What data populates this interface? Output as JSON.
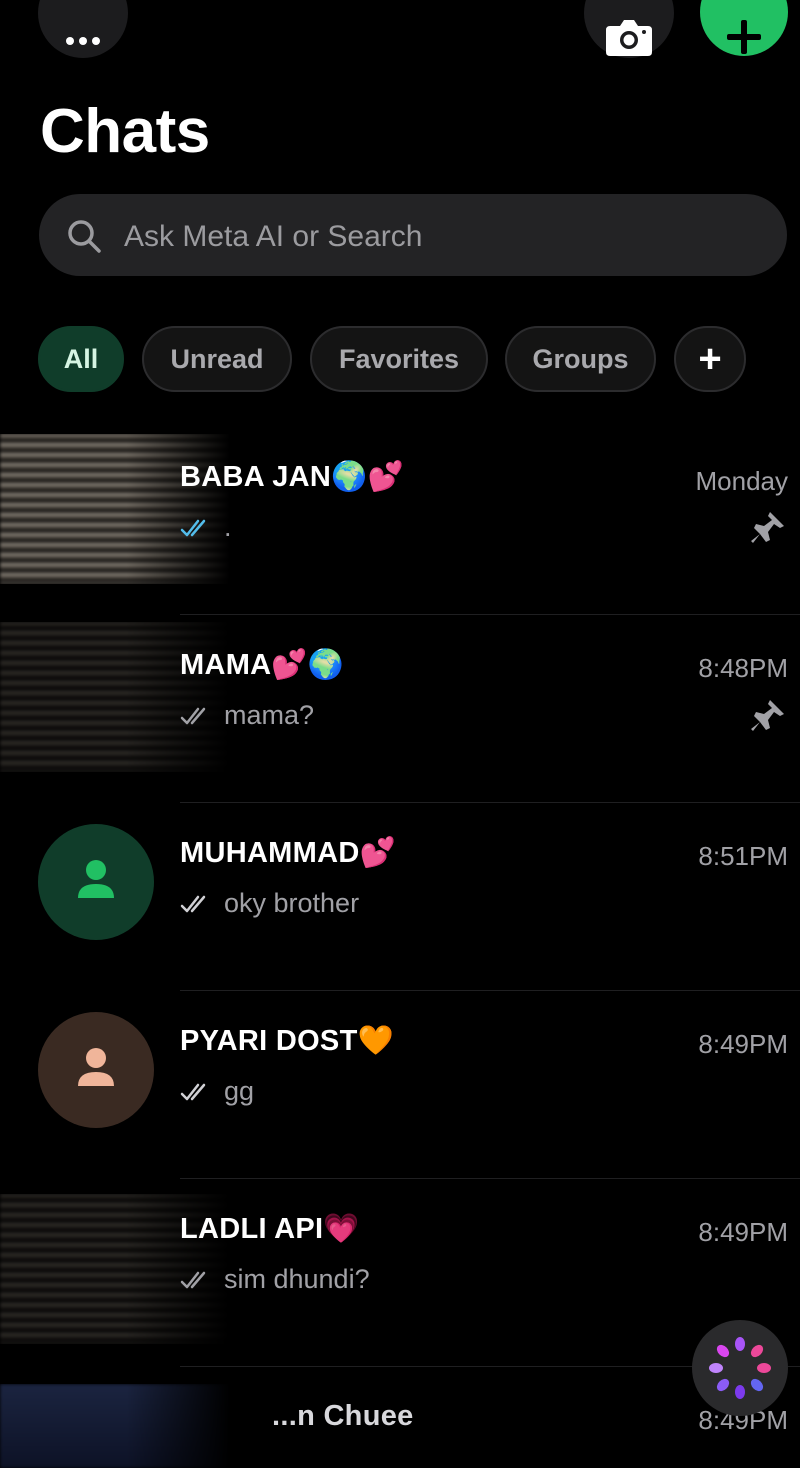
{
  "header": {
    "title": "Chats",
    "more_icon": "more-horizontal-icon",
    "camera_icon": "camera-icon",
    "new_chat_icon": "plus-icon"
  },
  "search": {
    "placeholder": "Ask Meta AI or Search",
    "icon": "search-icon"
  },
  "filters": {
    "items": [
      {
        "label": "All",
        "active": true
      },
      {
        "label": "Unread",
        "active": false
      },
      {
        "label": "Favorites",
        "active": false
      },
      {
        "label": "Groups",
        "active": false
      }
    ],
    "add_label": "+"
  },
  "chats": [
    {
      "name": "BABA JAN",
      "emoji": "🌍💕",
      "time": "Monday",
      "preview": ".",
      "ticks": "read",
      "pinned": true,
      "avatar": "blurred-photo"
    },
    {
      "name": "MAMA",
      "emoji": "💕🌍",
      "time": "8:48PM",
      "preview": "mama?",
      "ticks": "delivered",
      "pinned": true,
      "avatar": "blurred-photo"
    },
    {
      "name": "MUHAMMAD",
      "emoji": "💕",
      "time": "8:51PM",
      "preview": "oky brother",
      "ticks": "delivered",
      "pinned": false,
      "avatar": "default-green"
    },
    {
      "name": "PYARI DOST",
      "emoji": "🧡",
      "time": "8:49PM",
      "preview": "gg",
      "ticks": "delivered",
      "pinned": false,
      "avatar": "default-peach"
    },
    {
      "name": "LADLI API",
      "emoji": "💗",
      "time": "8:49PM",
      "preview": "sim dhundi?",
      "ticks": "delivered",
      "pinned": false,
      "avatar": "blurred-photo"
    },
    {
      "name": "...n Chuee",
      "emoji": "",
      "time": "8:49PM",
      "preview": "",
      "ticks": "",
      "pinned": false,
      "avatar": "blurred-photo"
    }
  ],
  "colors": {
    "accent_green": "#21c063",
    "active_chip_bg": "#103d2a",
    "read_tick": "#53bdeb",
    "meta_ai_gradient": "#a855f7"
  },
  "fab": {
    "icon": "meta-ai-icon"
  }
}
